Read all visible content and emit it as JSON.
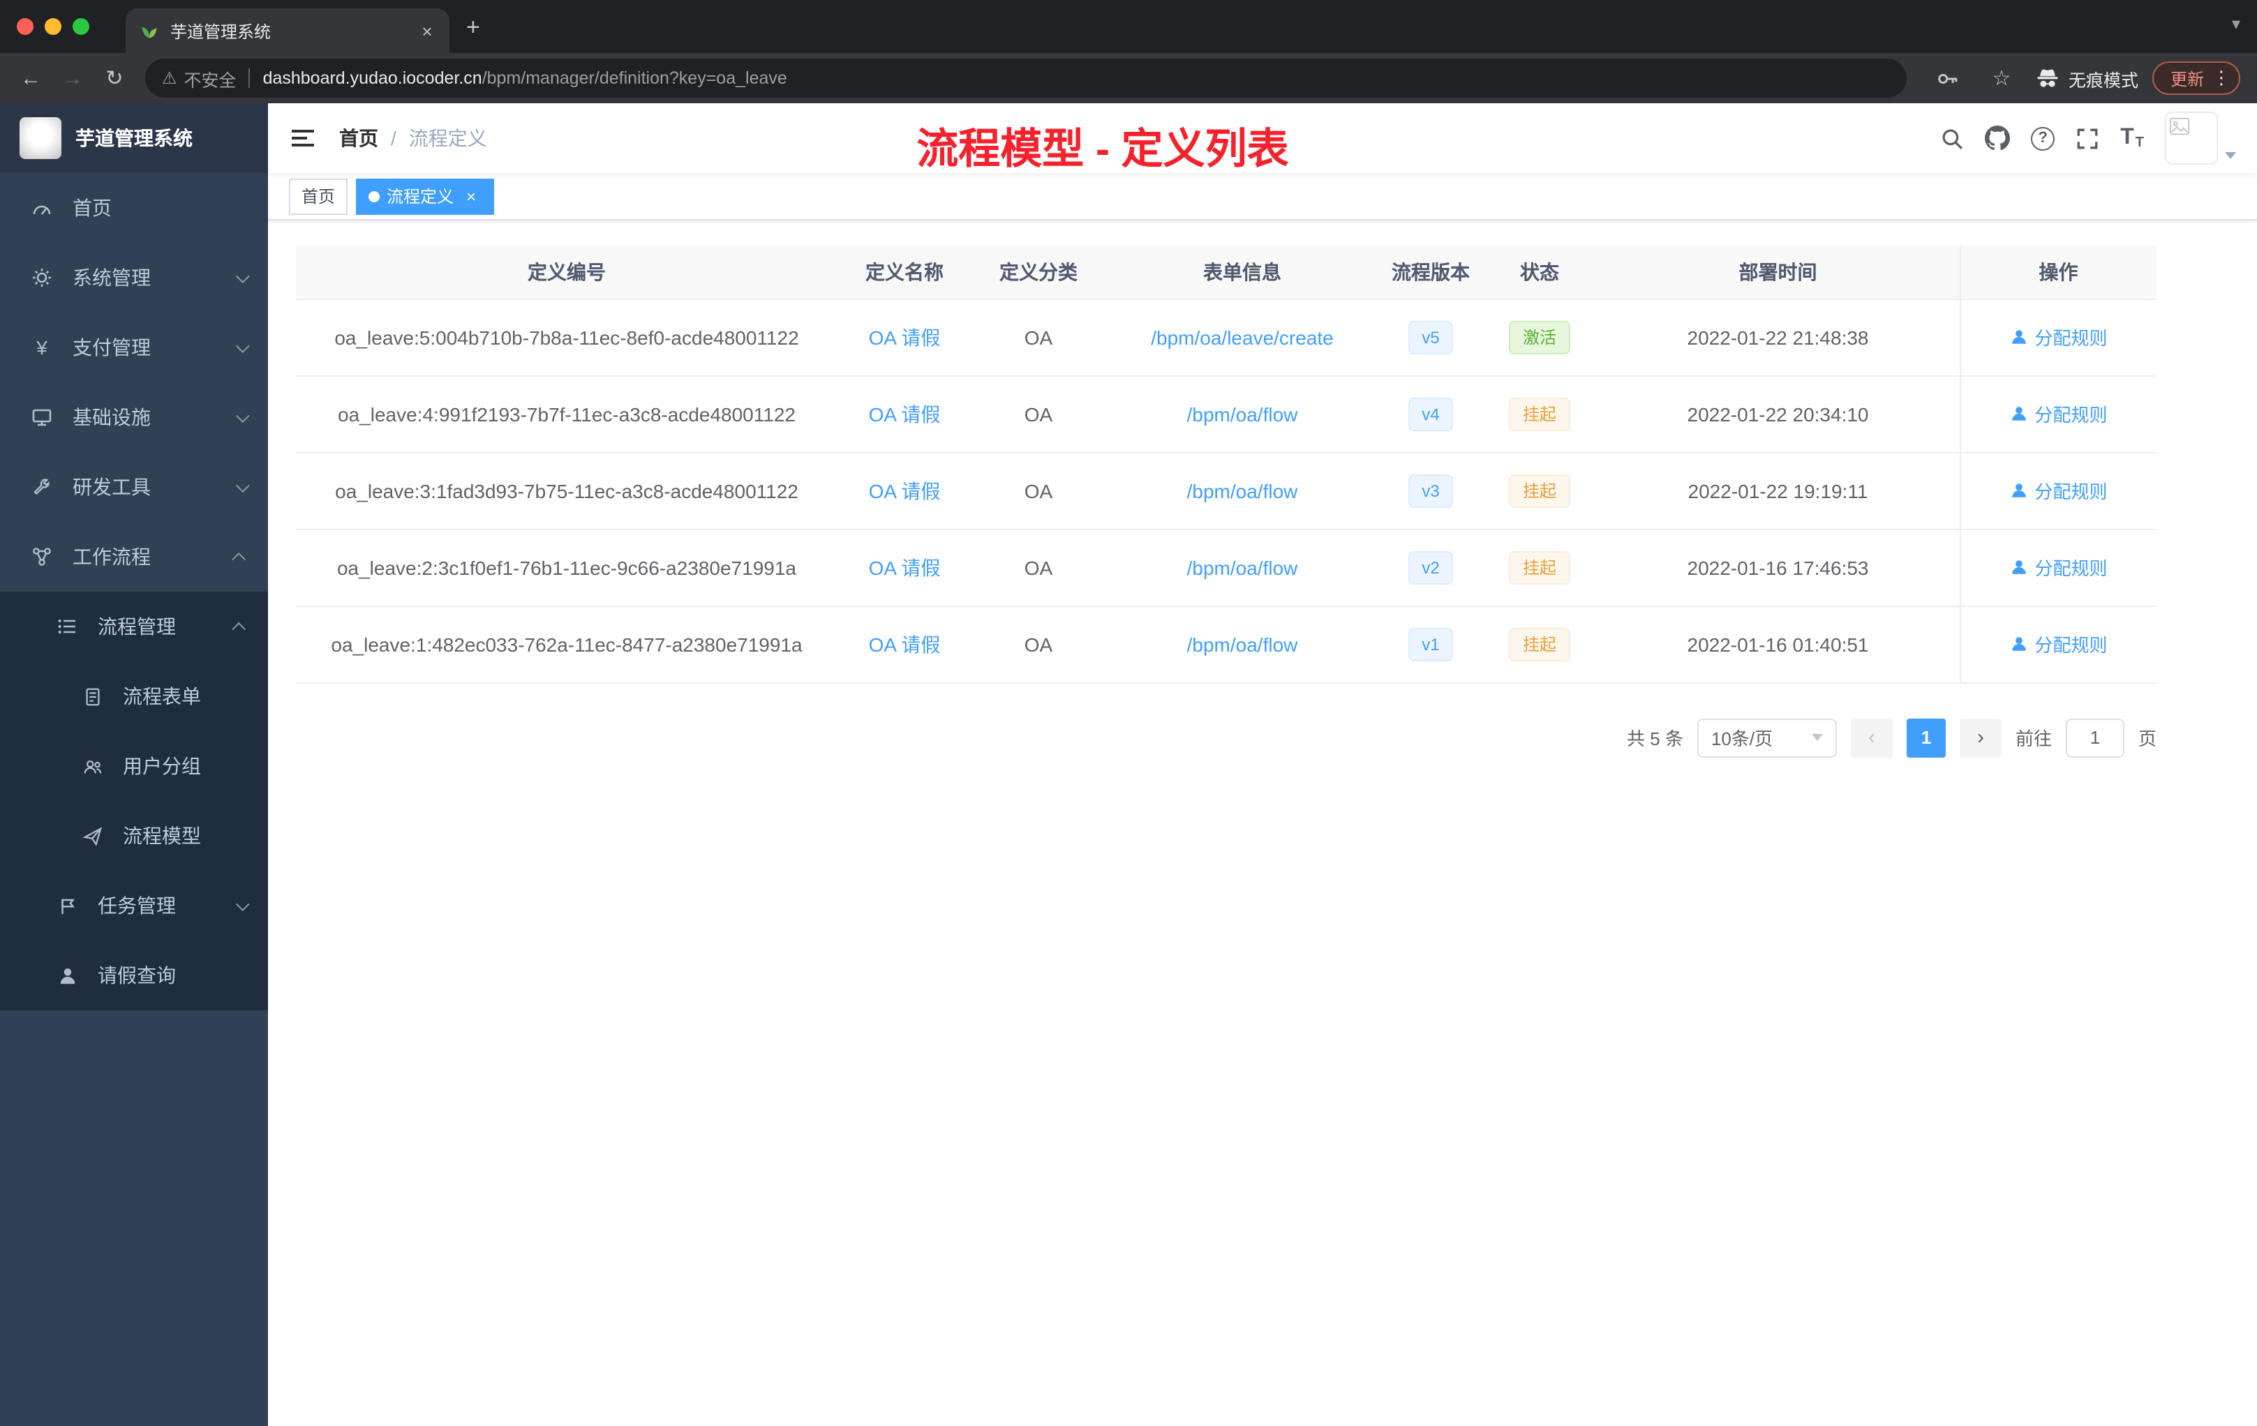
{
  "colors": {
    "accent_blue": "#409eff",
    "annotation_red": "#f5222d",
    "success_green": "#67c23a",
    "warning_orange": "#e6a23c",
    "sidebar_bg": "#304156",
    "submenu_bg": "#1f2d3d"
  },
  "glyphs": {
    "close": "×",
    "plus": "+",
    "chevron_down": "▾",
    "back": "←",
    "forward": "→",
    "reload": "↻",
    "warning": "⚠",
    "star": "☆",
    "kebab": "⋮",
    "yen": "¥",
    "question": "?",
    "font_t": "T",
    "prev": "‹",
    "next": "›",
    "slash": "/"
  },
  "browser": {
    "tab_title": "芋道管理系统",
    "address": {
      "security_label": "不安全",
      "host": "dashboard.yudao.iocoder.cn",
      "path": "/bpm/manager/definition?key=oa_leave"
    },
    "incognito_label": "无痕模式",
    "update_label": "更新"
  },
  "sidebar": {
    "app_title": "芋道管理系统",
    "menu": [
      {
        "label": "首页",
        "icon": "dashboard-icon"
      },
      {
        "label": "系统管理",
        "icon": "gear-icon"
      },
      {
        "label": "支付管理",
        "icon": "yen-icon"
      },
      {
        "label": "基础设施",
        "icon": "infrastructure-icon"
      },
      {
        "label": "研发工具",
        "icon": "tools-icon"
      },
      {
        "label": "工作流程",
        "icon": "workflow-icon"
      },
      {
        "label": "流程管理",
        "icon": "process-manage-icon"
      },
      {
        "label": "流程表单",
        "icon": "form-icon"
      },
      {
        "label": "用户分组",
        "icon": "user-group-icon"
      },
      {
        "label": "流程模型",
        "icon": "process-model-icon"
      },
      {
        "label": "任务管理",
        "icon": "task-icon"
      },
      {
        "label": "请假查询",
        "icon": "user-icon"
      }
    ]
  },
  "navbar": {
    "breadcrumb_home": "首页",
    "breadcrumb_current": "流程定义",
    "annotation": "流程模型 - 定义列表"
  },
  "tags": {
    "home": "首页",
    "active": "流程定义"
  },
  "table": {
    "columns": [
      "定义编号",
      "定义名称",
      "定义分类",
      "表单信息",
      "流程版本",
      "状态",
      "部署时间",
      "操作"
    ],
    "rows": [
      {
        "id": "oa_leave:5:004b710b-7b8a-11ec-8ef0-acde48001122",
        "name": "OA 请假",
        "category": "OA",
        "form": "/bpm/oa/leave/create",
        "version": "v5",
        "status": "激活",
        "time": "2022-01-22 21:48:38",
        "action": "分配规则"
      },
      {
        "id": "oa_leave:4:991f2193-7b7f-11ec-a3c8-acde48001122",
        "name": "OA 请假",
        "category": "OA",
        "form": "/bpm/oa/flow",
        "version": "v4",
        "status": "挂起",
        "time": "2022-01-22 20:34:10",
        "action": "分配规则"
      },
      {
        "id": "oa_leave:3:1fad3d93-7b75-11ec-a3c8-acde48001122",
        "name": "OA 请假",
        "category": "OA",
        "form": "/bpm/oa/flow",
        "version": "v3",
        "status": "挂起",
        "time": "2022-01-22 19:19:11",
        "action": "分配规则"
      },
      {
        "id": "oa_leave:2:3c1f0ef1-76b1-11ec-9c66-a2380e71991a",
        "name": "OA 请假",
        "category": "OA",
        "form": "/bpm/oa/flow",
        "version": "v2",
        "status": "挂起",
        "time": "2022-01-16 17:46:53",
        "action": "分配规则"
      },
      {
        "id": "oa_leave:1:482ec033-762a-11ec-8477-a2380e71991a",
        "name": "OA 请假",
        "category": "OA",
        "form": "/bpm/oa/flow",
        "version": "v1",
        "status": "挂起",
        "time": "2022-01-16 01:40:51",
        "action": "分配规则"
      }
    ]
  },
  "pagination": {
    "total": "共 5 条",
    "page_size": "10条/页",
    "current": "1",
    "goto_label": "前往",
    "goto_value": "1",
    "page_unit": "页"
  }
}
